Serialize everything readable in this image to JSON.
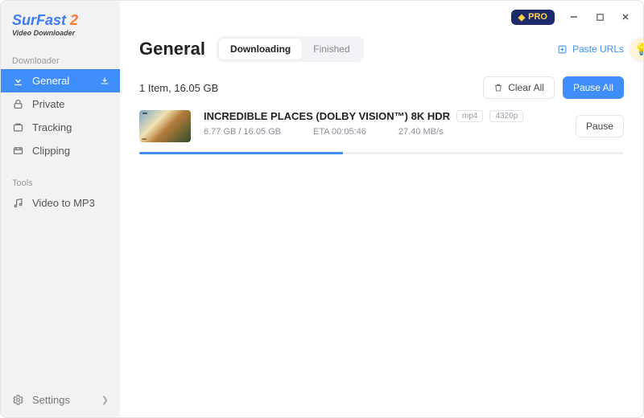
{
  "brand": {
    "name1": "SurFast",
    "name2": "2",
    "sub": "Video Downloader"
  },
  "sidebar": {
    "groups": {
      "downloader": {
        "label": "Downloader"
      },
      "tools": {
        "label": "Tools"
      }
    },
    "items": {
      "general": {
        "label": "General"
      },
      "private": {
        "label": "Private"
      },
      "tracking": {
        "label": "Tracking"
      },
      "clipping": {
        "label": "Clipping"
      },
      "vid2mp3": {
        "label": "Video to MP3"
      }
    },
    "footer": {
      "label": "Settings"
    }
  },
  "titlebar": {
    "pro": "PRO"
  },
  "header": {
    "title": "General",
    "tabs": {
      "downloading": "Downloading",
      "finished": "Finished"
    },
    "paste": "Paste URLs"
  },
  "summary": {
    "text": "1 Item, 16.05 GB",
    "clear": "Clear All",
    "pause": "Pause All"
  },
  "download": {
    "title": "INCREDIBLE PLACES (DOLBY VISION™) 8K HDR",
    "format": "mp4",
    "quality": "4320p",
    "size": "6.77 GB / 16.05 GB",
    "eta": "ETA 00:05:46",
    "speed": "27.40 MB/s",
    "action": "Pause",
    "progress_pct": 42
  }
}
